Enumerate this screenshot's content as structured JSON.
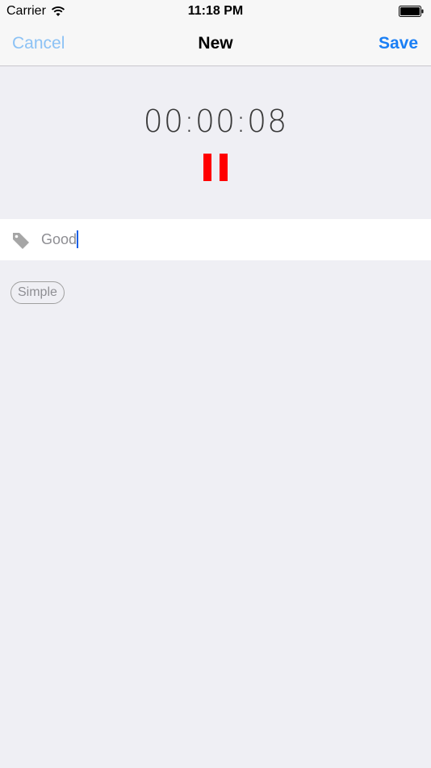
{
  "status_bar": {
    "carrier": "Carrier",
    "time": "11:18 PM",
    "wifi_icon": "wifi-icon",
    "battery_icon": "battery-icon"
  },
  "nav_bar": {
    "cancel_label": "Cancel",
    "title": "New",
    "save_label": "Save"
  },
  "timer": {
    "elapsed": "00:00:08",
    "pause_icon": "pause-icon"
  },
  "tag_field": {
    "icon": "tag-icon",
    "value": "Good"
  },
  "tags": [
    {
      "label": "Simple"
    }
  ],
  "colors": {
    "background": "#efeff4",
    "accent": "#1a7ff5",
    "cancel": "#8cc2f5",
    "pause": "#ff0000"
  }
}
